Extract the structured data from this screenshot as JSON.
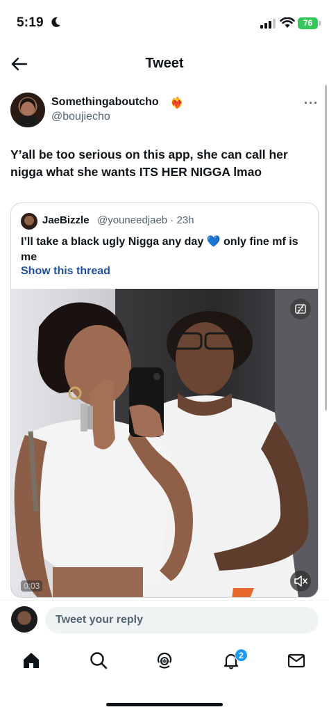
{
  "status": {
    "time": "5:19",
    "battery": "76",
    "icons": [
      "moon-icon",
      "signal-icon",
      "wifi-icon",
      "battery-icon"
    ]
  },
  "header": {
    "title": "Tweet",
    "back_icon": "back-arrow-icon"
  },
  "tweet": {
    "author_name": "Somethingaboutcho",
    "author_emoji": "❤️‍🔥",
    "author_handle": "@boujiecho",
    "more_label": "···",
    "text": "Y’all be too serious on this app, she can call her nigga what she wants ITS HER NIGGA lmao"
  },
  "quote": {
    "name": "JaeBizzle",
    "handle_time": "@youneedjaeb · 23h",
    "text_before": "I’ll take a black ugly Nigga any day ",
    "emoji": "💙",
    "text_after": " only fine mf is me",
    "show_thread": "Show this thread",
    "media": {
      "timecode": "0:03",
      "caption_icon": "closed-captions-icon",
      "mute_icon": "muted-speaker-icon"
    }
  },
  "reply": {
    "placeholder": "Tweet your reply"
  },
  "tabbar": {
    "items": [
      "home-icon",
      "search-icon",
      "spaces-icon",
      "notifications-icon",
      "messages-icon"
    ],
    "notification_count": "2"
  },
  "colors": {
    "accent": "#1d9bf0",
    "link": "#1d4f9c",
    "battery": "#34c759",
    "text": "#0f1419",
    "secondary": "#536471"
  }
}
